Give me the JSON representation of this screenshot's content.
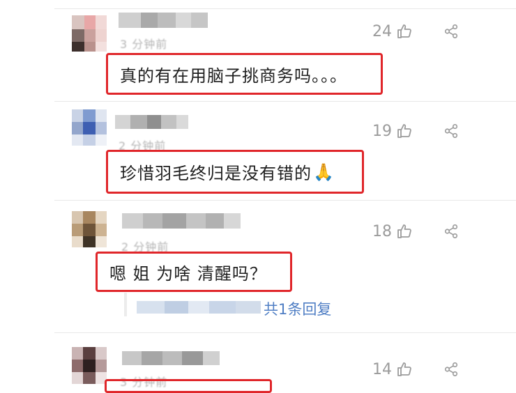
{
  "comments": [
    {
      "time": "3 分钟前",
      "like_count": "24",
      "content": "真的有在用脑子挑商务吗。。。"
    },
    {
      "time": "2 分钟前",
      "like_count": "19",
      "content": "珍惜羽毛终归是没有错的",
      "emoji": "🙏"
    },
    {
      "time": "2 分钟前",
      "like_count": "18",
      "content": "嗯 姐 为啥 清醒吗？",
      "reply_link": "共1条回复"
    },
    {
      "time": "3 分钟前",
      "like_count": "14"
    }
  ],
  "icons": {
    "like": "thumbs-up-icon",
    "share": "share-icon"
  },
  "colors": {
    "highlight_border": "#e0262a",
    "link": "#4f7ec4",
    "meta_text": "#9b9b9b"
  }
}
